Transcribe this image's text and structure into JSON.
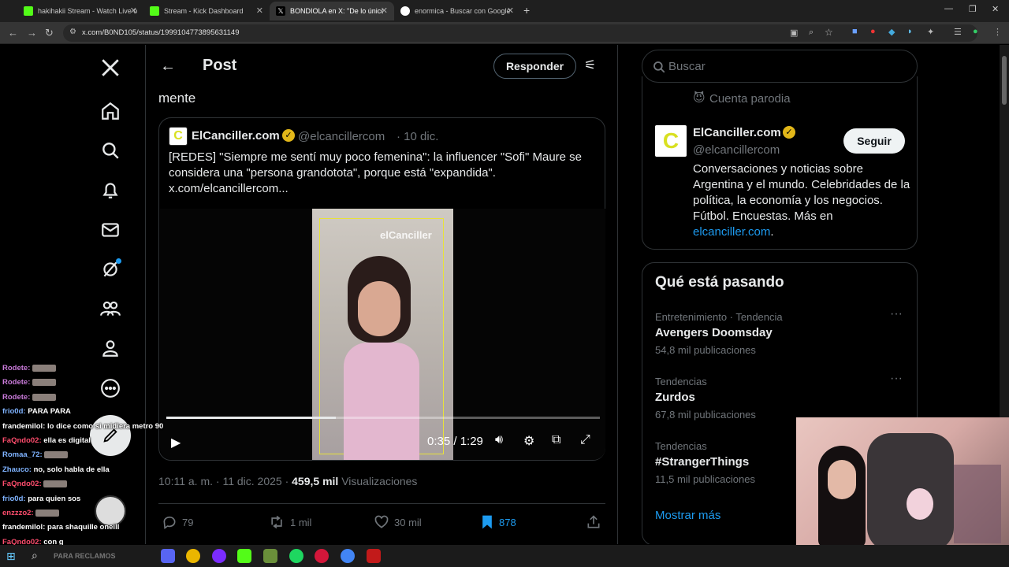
{
  "browser": {
    "tabs": [
      {
        "title": "hakihakii Stream - Watch Live o"
      },
      {
        "title": "Stream - Kick Dashboard"
      },
      {
        "title": "BONDIOLA en X: \"De lo único q"
      },
      {
        "title": "enormica - Buscar con Google"
      }
    ],
    "url": "x.com/B0ND105/status/1999104773895631149"
  },
  "header": {
    "title": "Post",
    "reply_button": "Responder"
  },
  "post": {
    "text_tail": "mente",
    "quoted": {
      "name": "ElCanciller.com",
      "handle": "@elcancillercom",
      "date": "· 10 dic.",
      "text": "[REDES] \"Siempre me sentí muy poco femenina\": la influencer \"Sofi\" Maure se considera una \"persona grandotota\", porque está \"expandida\". x.com/elcancillercom...",
      "video_watermark": "elCanciller",
      "video_time": "0:35 / 1:29",
      "progress": 0.39
    },
    "meta": {
      "time": "10:11 a. m. · 11 dic. 2025 ·",
      "views": "459,5 mil",
      "views_label": "Visualizaciones"
    },
    "actions": {
      "replies": "79",
      "reposts": "1 mil",
      "likes": "30 mil",
      "bookmarks": "878"
    }
  },
  "sidebar": {
    "search_placeholder": "Buscar",
    "parody_label": "Cuenta parodia",
    "profile": {
      "name": "ElCanciller.com",
      "handle": "@elcancillercom",
      "follow": "Seguir",
      "bio": "Conversaciones y noticias sobre Argentina y el mundo. Celebridades de la política, la economía y los negocios. Fútbol. Encuestas. Más en",
      "link": "elcanciller.com",
      "bio_end": "."
    },
    "trending": {
      "title": "Qué está pasando",
      "items": [
        {
          "category": "Entretenimiento · Tendencia",
          "name": "Avengers Doomsday",
          "count": "54,8 mil publicaciones"
        },
        {
          "category": "Tendencias",
          "name": "Zurdos",
          "count": "67,8 mil publicaciones"
        },
        {
          "category": "Tendencias",
          "name": "#StrangerThings",
          "count": "11,5 mil publicaciones"
        }
      ],
      "show_more": "Mostrar más"
    }
  },
  "chat": [
    {
      "user": "Rodete:",
      "msg": "",
      "color": "#c97ad9"
    },
    {
      "user": "Rodete:",
      "msg": "",
      "color": "#c97ad9"
    },
    {
      "user": "Rodete:",
      "msg": "",
      "color": "#c97ad9"
    },
    {
      "user": "frio0d:",
      "msg": "PARA PARA",
      "color": "#7fb3ff"
    },
    {
      "user": "frandemilol:",
      "msg": "lo dice como si midiera metro 90",
      "color": "#ffffff"
    },
    {
      "user": "FaQndo02:",
      "msg": "ella es digital",
      "color": "#ff4d6d"
    },
    {
      "user": "Romaa_72:",
      "msg": "",
      "color": "#7fb3ff"
    },
    {
      "user": "Zhauco:",
      "msg": "no, solo habla de ella",
      "color": "#7fb3ff"
    },
    {
      "user": "FaQndo02:",
      "msg": "",
      "color": "#ff4d6d"
    },
    {
      "user": "frio0d:",
      "msg": "para quien sos",
      "color": "#7fb3ff"
    },
    {
      "user": "enzzzo2:",
      "msg": "",
      "color": "#ff4d6d"
    },
    {
      "user": "frandemilol:",
      "msg": "para shaquille oneill",
      "color": "#ffffff"
    },
    {
      "user": "FaQndo02:",
      "msg": "con g",
      "color": "#ff4d6d"
    }
  ],
  "taskbar": {
    "search_hint": "PARA RECLAMOS"
  },
  "colors": {
    "accent": "#1d9bf0",
    "verified": "#e2b719",
    "bg": "#000000",
    "border": "#2f3336"
  }
}
